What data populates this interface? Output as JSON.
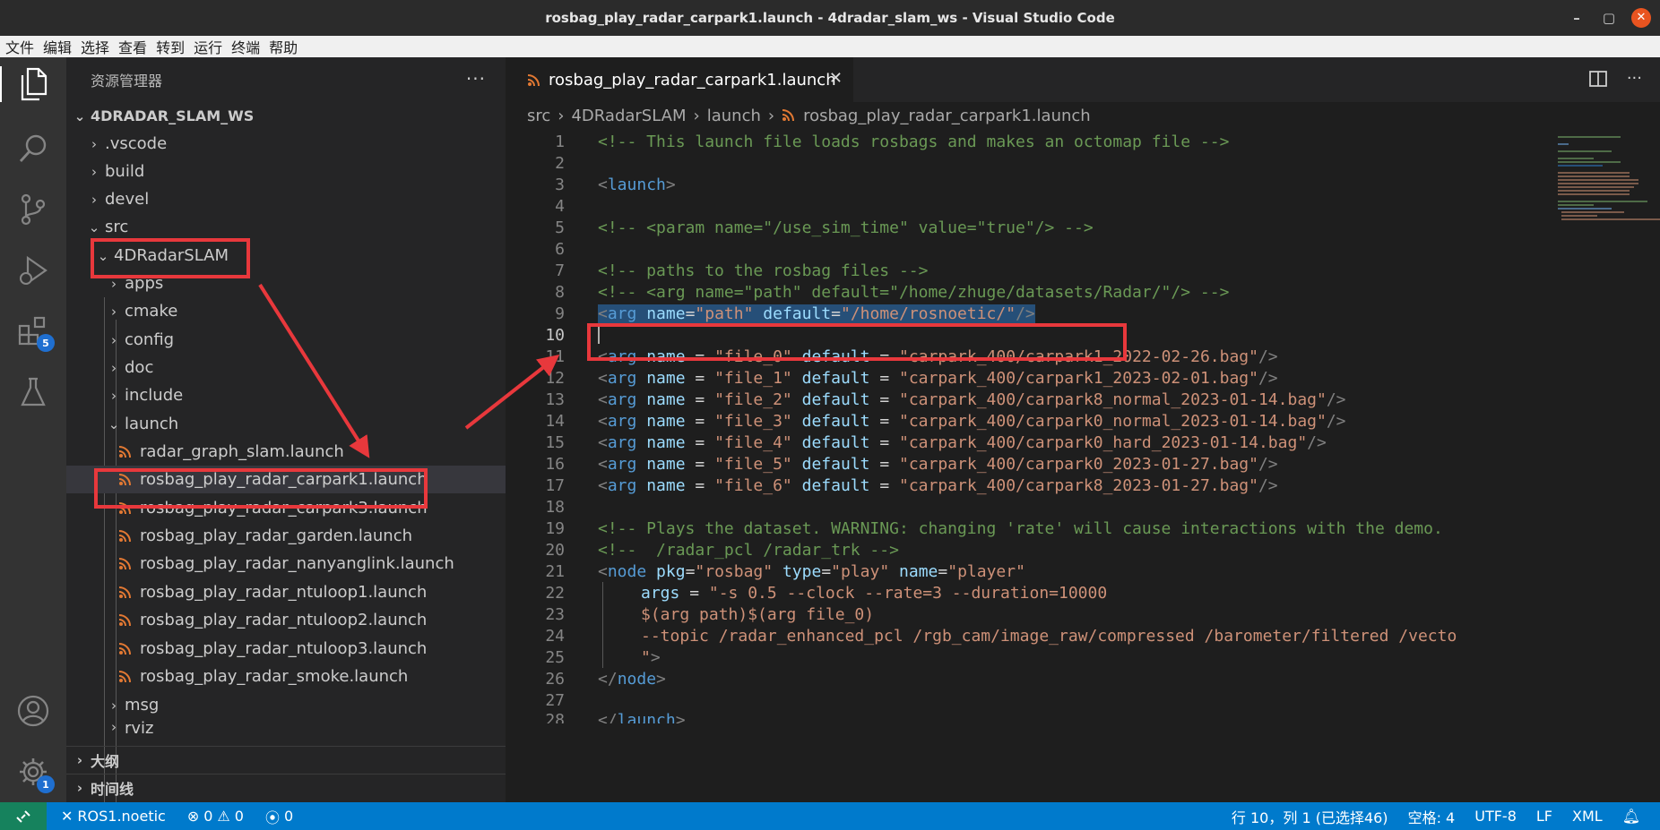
{
  "window": {
    "title": "rosbag_play_radar_carpark1.launch - 4dradar_slam_ws - Visual Studio Code",
    "minimize": "–",
    "maximize": "▢",
    "close": "✕"
  },
  "menu": [
    "文件",
    "编辑",
    "选择",
    "查看",
    "转到",
    "运行",
    "终端",
    "帮助"
  ],
  "activity": {
    "extensions_badge": "5",
    "settings_badge": "1"
  },
  "sidebar": {
    "title": "资源管理器",
    "more": "···",
    "workspace": "4DRADAR_SLAM_WS",
    "items": [
      {
        "label": ".vscode",
        "chev": "›"
      },
      {
        "label": "build",
        "chev": "›"
      },
      {
        "label": "devel",
        "chev": "›"
      },
      {
        "label": "src",
        "chev": "⌄"
      },
      {
        "label": "4DRadarSLAM",
        "chev": "⌄"
      },
      {
        "label": "apps",
        "chev": "›"
      },
      {
        "label": "cmake",
        "chev": "›"
      },
      {
        "label": "config",
        "chev": "›"
      },
      {
        "label": "doc",
        "chev": "›"
      },
      {
        "label": "include",
        "chev": "›"
      },
      {
        "label": "launch",
        "chev": "⌄"
      },
      {
        "label": "radar_graph_slam.launch"
      },
      {
        "label": "rosbag_play_radar_carpark1.launch"
      },
      {
        "label": "rosbag_play_radar_carpark3.launch"
      },
      {
        "label": "rosbag_play_radar_garden.launch"
      },
      {
        "label": "rosbag_play_radar_nanyanglink.launch"
      },
      {
        "label": "rosbag_play_radar_ntuloop1.launch"
      },
      {
        "label": "rosbag_play_radar_ntuloop2.launch"
      },
      {
        "label": "rosbag_play_radar_ntuloop3.launch"
      },
      {
        "label": "rosbag_play_radar_smoke.launch"
      },
      {
        "label": "msg",
        "chev": "›"
      },
      {
        "label": "rviz",
        "chev": "›"
      }
    ],
    "outline": "大纲",
    "timeline": "时间线"
  },
  "editor": {
    "tab": "rosbag_play_radar_carpark1.launch",
    "breadcrumb": [
      "src",
      "4DRadarSLAM",
      "launch",
      "rosbag_play_radar_carpark1.launch"
    ],
    "line_numbers": [
      "1",
      "2",
      "3",
      "4",
      "5",
      "6",
      "7",
      "8",
      "9",
      "10",
      "11",
      "12",
      "13",
      "14",
      "15",
      "16",
      "17",
      "18",
      "19",
      "20",
      "21",
      "22",
      "23",
      "24",
      "25",
      "26",
      "27",
      "28"
    ],
    "lines": {
      "l1": "<!-- This launch file loads rosbags and makes an octomap file -->",
      "l3_open": "<",
      "l3_tag": "launch",
      "l3_close": ">",
      "l5": "<!-- <param name=\"/use_sim_time\" value=\"true\"/> -->",
      "l7": "<!-- paths to the rosbag files -->",
      "l8": "<!-- <arg name=\"path\" default=\"/home/zhuge/datasets/Radar/\"/> -->",
      "l9_value": "\"/home/rosnoetic/\"",
      "args": [
        {
          "name": "\"file_0\"",
          "default": "\"carpark_400/carpark1_2022-02-26.bag\""
        },
        {
          "name": "\"file_1\"",
          "default": "\"carpark_400/carpark1_2023-02-01.bag\""
        },
        {
          "name": "\"file_2\"",
          "default": "\"carpark_400/carpark8_normal_2023-01-14.bag\""
        },
        {
          "name": "\"file_3\"",
          "default": "\"carpark_400/carpark0_normal_2023-01-14.bag\""
        },
        {
          "name": "\"file_4\"",
          "default": "\"carpark_400/carpark0_hard_2023-01-14.bag\""
        },
        {
          "name": "\"file_5\"",
          "default": "\"carpark_400/carpark0_2023-01-27.bag\""
        },
        {
          "name": "\"file_6\"",
          "default": "\"carpark_400/carpark8_2023-01-27.bag\""
        }
      ],
      "l19": "<!-- Plays the dataset. WARNING: changing 'rate' will cause interactions with the demo.",
      "l20": "<!--  /radar_pcl /radar_trk -->",
      "l21_pkg": "\"rosbag\"",
      "l21_type": "\"play\"",
      "l21_name": "\"player\"",
      "l22": "args = \"-s 0.5 --clock --rate=3 --duration=10000",
      "l23": "$(arg path)$(arg file_0)",
      "l24": "--topic /radar_enhanced_pcl /rgb_cam/image_raw/compressed /barometer/filtered /vecto",
      "l25": "\">",
      "l26": "</node>",
      "l28": "</launch>"
    }
  },
  "status": {
    "remote_name": "ROS1.noetic",
    "errors": "0",
    "warnings": "0",
    "ports": "0",
    "position": "行 10，列 1 (已选择46)",
    "spaces": "空格: 4",
    "encoding": "UTF-8",
    "eol": "LF",
    "language": "XML"
  }
}
